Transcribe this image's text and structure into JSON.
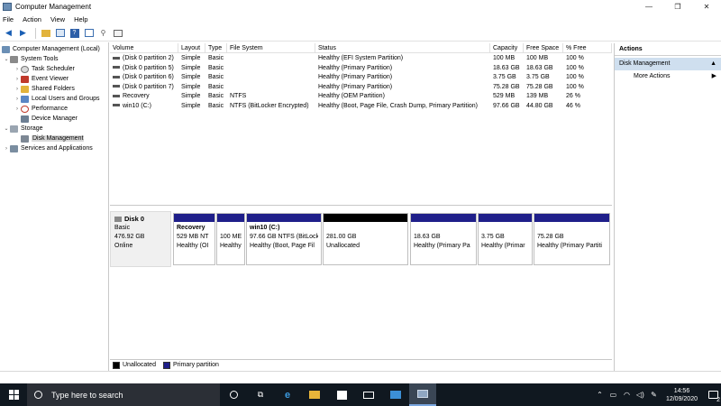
{
  "window": {
    "title": "Computer Management",
    "minimize": "—",
    "maximize": "❐",
    "close": "✕"
  },
  "menu": [
    "File",
    "Action",
    "View",
    "Help"
  ],
  "tree": {
    "root": "Computer Management (Local)",
    "system_tools": "System Tools",
    "task_scheduler": "Task Scheduler",
    "event_viewer": "Event Viewer",
    "shared_folders": "Shared Folders",
    "local_users": "Local Users and Groups",
    "performance": "Performance",
    "device_manager": "Device Manager",
    "storage": "Storage",
    "disk_management": "Disk Management",
    "services_apps": "Services and Applications"
  },
  "volume_columns": [
    "Volume",
    "Layout",
    "Type",
    "File System",
    "Status",
    "Capacity",
    "Free Space",
    "% Free"
  ],
  "volumes": [
    [
      "(Disk 0 partition 2)",
      "Simple",
      "Basic",
      "",
      "Healthy (EFI System Partition)",
      "100 MB",
      "100 MB",
      "100 %"
    ],
    [
      "(Disk 0 partition 5)",
      "Simple",
      "Basic",
      "",
      "Healthy (Primary Partition)",
      "18.63 GB",
      "18.63 GB",
      "100 %"
    ],
    [
      "(Disk 0 partition 6)",
      "Simple",
      "Basic",
      "",
      "Healthy (Primary Partition)",
      "3.75 GB",
      "3.75 GB",
      "100 %"
    ],
    [
      "(Disk 0 partition 7)",
      "Simple",
      "Basic",
      "",
      "Healthy (Primary Partition)",
      "75.28 GB",
      "75.28 GB",
      "100 %"
    ],
    [
      "Recovery",
      "Simple",
      "Basic",
      "NTFS",
      "Healthy (OEM Partition)",
      "529 MB",
      "139 MB",
      "26 %"
    ],
    [
      "win10 (C:)",
      "Simple",
      "Basic",
      "NTFS (BitLocker Encrypted)",
      "Healthy (Boot, Page File, Crash Dump, Primary Partition)",
      "97.66 GB",
      "44.80 GB",
      "46 %"
    ]
  ],
  "disk": {
    "name": "Disk 0",
    "type": "Basic",
    "size": "476.92 GB",
    "status": "Online"
  },
  "partitions": [
    {
      "kind": "primary",
      "name": "Recovery",
      "l1": "529 MB NT",
      "l2": "Healthy (OI"
    },
    {
      "kind": "primary",
      "name": "",
      "l1": "100 ME",
      "l2": "Healthy"
    },
    {
      "kind": "primary",
      "name": "win10  (C:)",
      "l1": "97.66 GB NTFS (BitLock",
      "l2": "Healthy (Boot, Page Fil"
    },
    {
      "kind": "unalloc",
      "name": "",
      "l1": "281.00 GB",
      "l2": "Unallocated"
    },
    {
      "kind": "primary",
      "name": "",
      "l1": "18.63 GB",
      "l2": "Healthy (Primary Pa"
    },
    {
      "kind": "primary",
      "name": "",
      "l1": "3.75 GB",
      "l2": "Healthy (Primar"
    },
    {
      "kind": "primary",
      "name": "",
      "l1": "75.28 GB",
      "l2": "Healthy (Primary Partiti"
    }
  ],
  "legend": {
    "unallocated": "Unallocated",
    "primary": "Primary partition"
  },
  "actions": {
    "header": "Actions",
    "section": "Disk Management",
    "more": "More Actions"
  },
  "taskbar": {
    "search_placeholder": "Type here to search",
    "time": "14:56",
    "date": "12/09/2020",
    "notifications": "2"
  },
  "colors": {
    "primary_partition": "#1f1f8a",
    "unallocated": "#000000",
    "taskbar": "#101820",
    "actions_highlight": "#cfdfef"
  }
}
